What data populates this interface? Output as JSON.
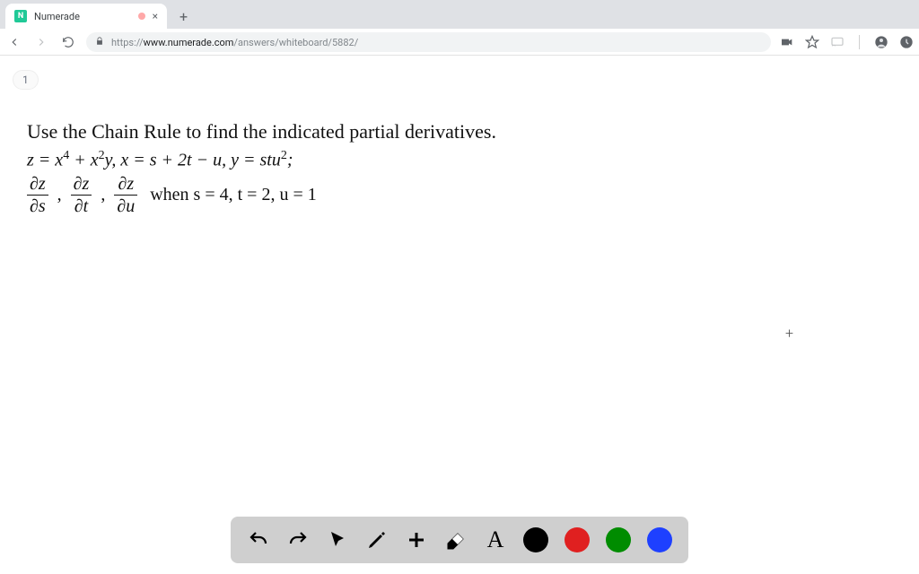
{
  "browser": {
    "tab_title": "Numerade",
    "favicon_letter": "N",
    "url_host": "www.numerade.com",
    "url_path": "/answers/whiteboard/5882/",
    "url_scheme": "https://"
  },
  "page_indicator": "1",
  "problem": {
    "prompt": "Use the Chain Rule to find the indicated partial derivatives.",
    "equation_line": "z = x⁴ + x²y, x = s + 2t − u, y = stu²;",
    "partial_s_n": "∂z",
    "partial_s_d": "∂s",
    "partial_t_n": "∂z",
    "partial_t_d": "∂t",
    "partial_u_n": "∂z",
    "partial_u_d": "∂u",
    "condition": " when s = 4, t = 2, u = 1",
    "sep": ","
  },
  "toolbar": {
    "undo": "undo",
    "redo": "redo",
    "pointer": "pointer",
    "pen": "pen",
    "add": "add",
    "eraser": "eraser",
    "text": "A",
    "colors": {
      "black": "#000000",
      "red": "#e02020",
      "green": "#008c00",
      "blue": "#1e40ff"
    }
  },
  "plus_marker": "+"
}
